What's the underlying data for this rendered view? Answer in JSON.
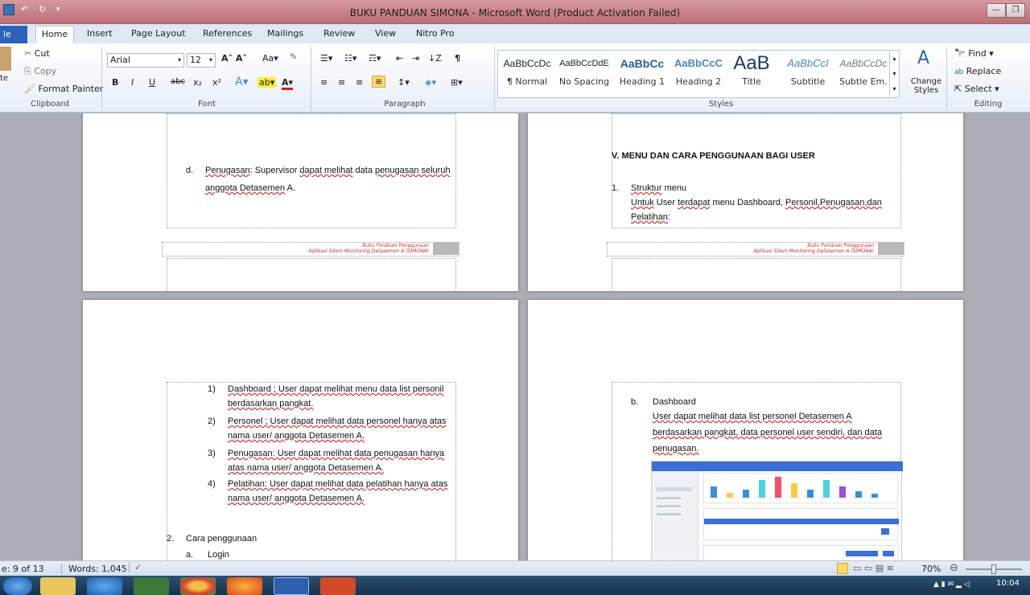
{
  "window": {
    "title": "BUKU PANDUAN SIMONA - Microsoft Word (Product Activation Failed)"
  },
  "tabs": {
    "file": "le",
    "home": "Home",
    "insert": "Insert",
    "page_layout": "Page Layout",
    "references": "References",
    "mailings": "Mailings",
    "review": "Review",
    "view": "View",
    "nitro": "Nitro Pro"
  },
  "clipboard": {
    "paste": "te",
    "cut": "Cut",
    "copy": "Copy",
    "format_painter": "Format Painter",
    "label": "Clipboard"
  },
  "font": {
    "name": "Arial",
    "size": "12",
    "label": "Font",
    "bold": "B",
    "italic": "I",
    "underline": "U"
  },
  "paragraph": {
    "label": "Paragraph"
  },
  "styles": {
    "label": "Styles",
    "items": [
      {
        "preview": "AaBbCcDc",
        "name": "¶ Normal"
      },
      {
        "preview": "AaBbCcDdE",
        "name": "No Spacing"
      },
      {
        "preview": "AaBbCc",
        "name": "Heading 1"
      },
      {
        "preview": "AaBbCcC",
        "name": "Heading 2"
      },
      {
        "preview": "AaB",
        "name": "Title"
      },
      {
        "preview": "AaBbCcI",
        "name": "Subtitle"
      },
      {
        "preview": "AaBbCcDc",
        "name": "Subtle Em..."
      }
    ],
    "change_styles": "Change Styles"
  },
  "editing": {
    "find": "Find",
    "replace": "Replace",
    "select": "Select",
    "label": "Editing"
  },
  "doc": {
    "page1": {
      "item_d_label": "d.",
      "item_d_line1_a": "Penugasan",
      "item_d_line1_b": ": Supervisor ",
      "item_d_line1_c": "dapat melihat",
      "item_d_line1_d": " data ",
      "item_d_line1_e": "penugasan seluruh",
      "item_d_line2_a": "anggota Detasemen",
      "item_d_line2_b": " A."
    },
    "page2": {
      "heading": "V.    MENU DAN CARA PENGGUNAAN BAGI USER",
      "num": "1.",
      "sub1": "Struktur",
      "sub1b": " menu",
      "line1a": "Untuk",
      "line1b": " User ",
      "line1c": "terdapat",
      "line1d": " menu Dashboard, ",
      "line1e": "Personil,Penugasan,dan",
      "line2": "Pelatihan",
      "line2b": ":"
    },
    "footer": {
      "line1": "Buku Panduan Penggunaan",
      "line2": "Aplikasi Sitem Monitoring Detasemen A (SIMONA)"
    },
    "page3": {
      "items": [
        {
          "num": "1)",
          "l1": "Dashboard ; User dapat melihat menu data list personil",
          "l2": "berdasarkan pangkat."
        },
        {
          "num": "2)",
          "l1": "Personel ; User dapat melihat data personel hanya atas",
          "l2": "nama user/ anggota Detasemen A."
        },
        {
          "num": "3)",
          "l1": "Penugasan: User dapat melihat data penugasan hanya",
          "l2": "atas nama user/ anggota Detasemen A."
        },
        {
          "num": "4)",
          "l1": "Pelatihan: User dapat melihat data pelatihan hanya atas",
          "l2": "nama user/ anggota Detasemen A."
        }
      ],
      "sec2_num": "2.",
      "sec2": "Cara penggunaan",
      "sub_a_num": "a.",
      "sub_a": "Login"
    },
    "page4": {
      "b_num": "b.",
      "b_title": "Dashboard",
      "l1": "User  dapat  melihat  data  list  personel  Detasemen  A",
      "l2": "berdasarkan  pangkat,  data  personel  user  sendiri,  dan  data",
      "l3": "penugasan."
    }
  },
  "status": {
    "page": "e: 9 of 13",
    "words": "Words: 1,045",
    "zoom": "70%",
    "time": "10:04"
  }
}
